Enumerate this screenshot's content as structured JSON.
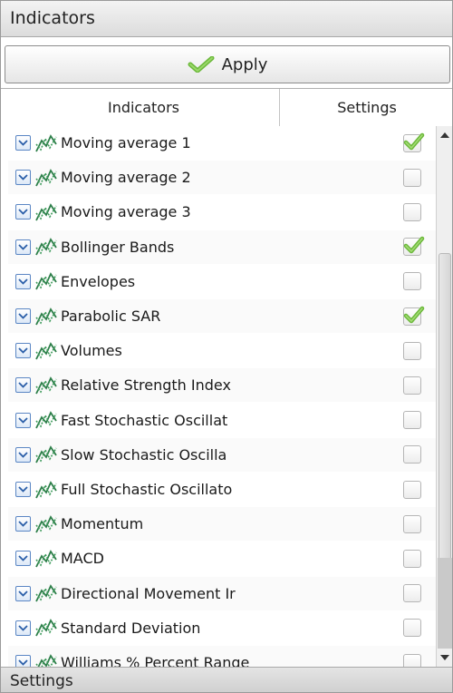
{
  "header": {
    "title": "Indicators"
  },
  "toolbar": {
    "apply_label": "Apply",
    "apply_icon": "checkmark-icon"
  },
  "tabs": [
    {
      "label": "Indicators"
    },
    {
      "label": "Settings"
    }
  ],
  "indicators": [
    {
      "label": "Moving average 1",
      "checked": true
    },
    {
      "label": "Moving average 2",
      "checked": false
    },
    {
      "label": "Moving average 3",
      "checked": false
    },
    {
      "label": "Bollinger Bands",
      "checked": true
    },
    {
      "label": "Envelopes",
      "checked": false
    },
    {
      "label": "Parabolic SAR",
      "checked": true
    },
    {
      "label": "Volumes",
      "checked": false
    },
    {
      "label": "Relative Strength Index",
      "checked": false
    },
    {
      "label": "Fast Stochastic Oscillat",
      "checked": false
    },
    {
      "label": "Slow Stochastic Oscilla",
      "checked": false
    },
    {
      "label": "Full Stochastic Oscillato",
      "checked": false
    },
    {
      "label": "Momentum",
      "checked": false
    },
    {
      "label": "MACD",
      "checked": false
    },
    {
      "label": "Directional Movement Ir",
      "checked": false
    },
    {
      "label": "Standard Deviation",
      "checked": false
    },
    {
      "label": "Williams % Percent Range",
      "checked": false
    }
  ],
  "footer": {
    "title": "Settings"
  },
  "colors": {
    "check": "#6bb83a",
    "expander_border": "#5a86c4",
    "icon": "#2e7f4a"
  }
}
